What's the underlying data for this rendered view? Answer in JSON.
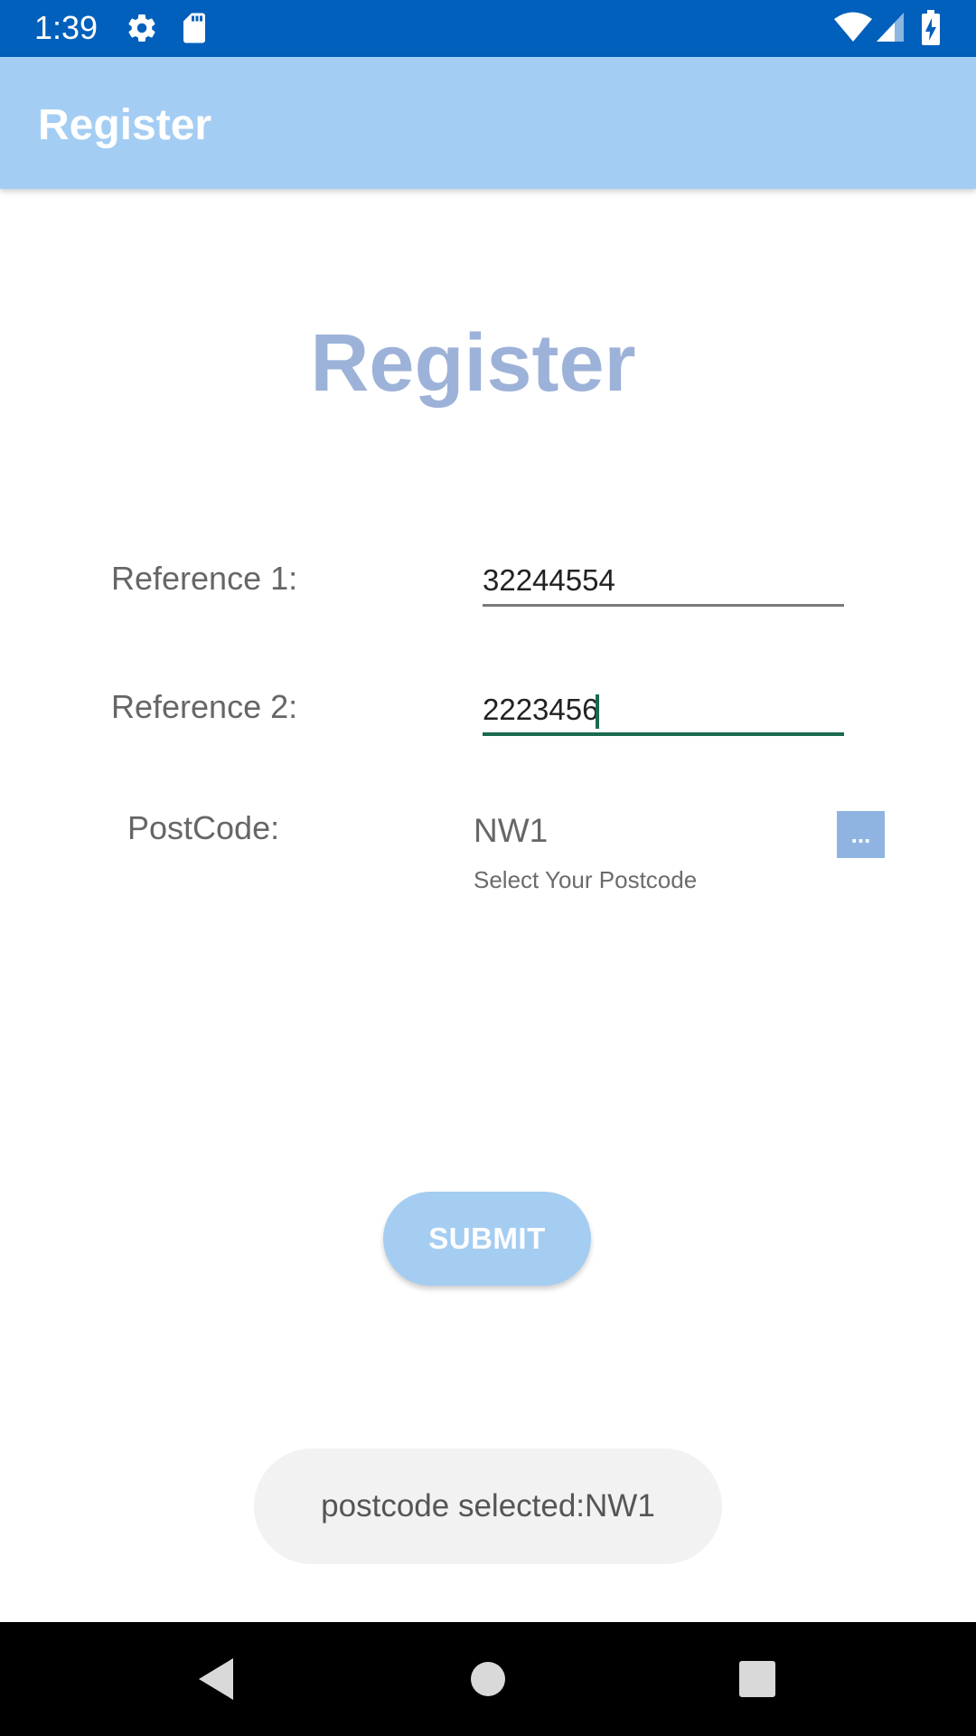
{
  "status_bar": {
    "time": "1:39",
    "icons": [
      "settings-icon",
      "sd-card-icon",
      "wifi-icon",
      "signal-icon",
      "battery-charging-icon"
    ]
  },
  "app_bar": {
    "title": "Register",
    "color": "#a4cdf3"
  },
  "heading": "Register",
  "form": {
    "reference1": {
      "label": "Reference 1:",
      "value": "32244554"
    },
    "reference2": {
      "label": "Reference 2:",
      "value": "2223456"
    },
    "postcode": {
      "label": "PostCode:",
      "value": "NW1",
      "hint": "Select Your Postcode",
      "button_label": "..."
    }
  },
  "submit_label": "SUBMIT",
  "toast": "postcode selected:NW1",
  "nav_bar": {
    "icons": [
      "back-icon",
      "home-icon",
      "recents-icon"
    ]
  },
  "colors": {
    "status_bar": "#0060bb",
    "heading": "#9db2d8",
    "focus_underline": "#1a6a4d",
    "submit_button": "#a5cdf1"
  }
}
